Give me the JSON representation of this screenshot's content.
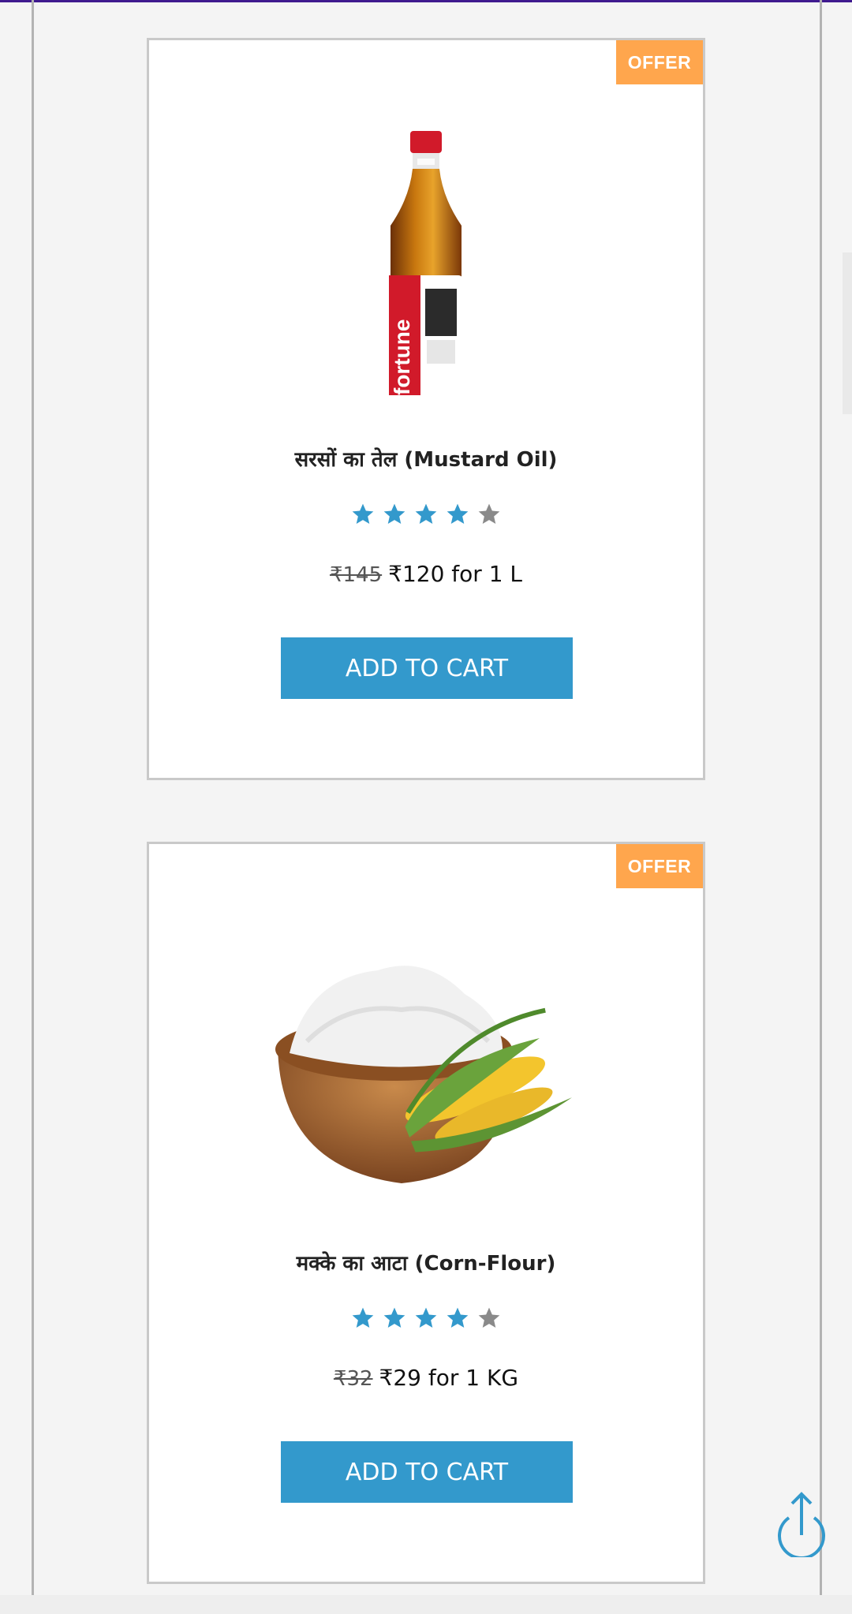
{
  "colors": {
    "accent": "#3399cc",
    "offer_badge": "#ffa64d",
    "star_inactive": "#8a8a8a",
    "top_bar": "#3f1a8f"
  },
  "products": [
    {
      "offer_label": "OFFER",
      "name": "सरसों का तेल (Mustard Oil)",
      "image_icon": "mustard-oil-bottle-icon",
      "bottle_label": "fortune",
      "rating": 4,
      "rating_max": 5,
      "old_price": "₹145",
      "price_text": "₹120 for 1 L",
      "button_label": "ADD TO CART"
    },
    {
      "offer_label": "OFFER",
      "name": "मक्के का आटा (Corn-Flour)",
      "image_icon": "corn-flour-bowl-icon",
      "rating": 4,
      "rating_max": 5,
      "old_price": "₹32",
      "price_text": "₹29 for 1 KG",
      "button_label": "ADD TO CART"
    }
  ],
  "back_to_top_icon": "back-to-top-arrow-icon"
}
